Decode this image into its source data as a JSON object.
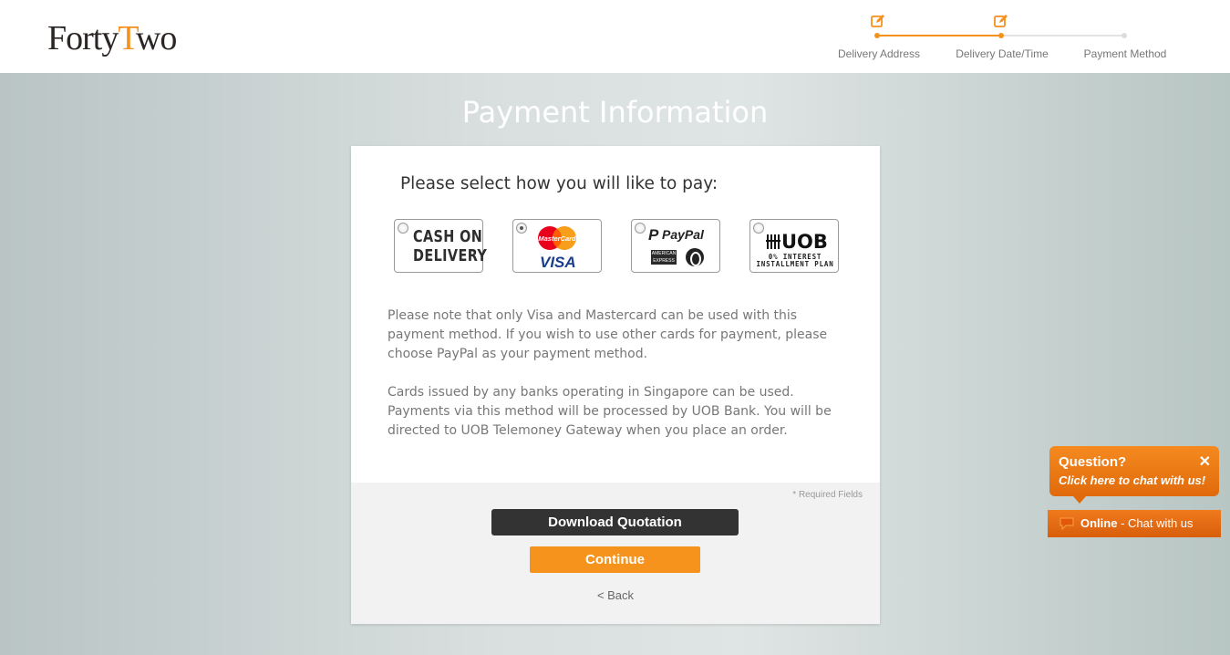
{
  "header": {
    "logo": {
      "part1": "Forty",
      "part2": "T",
      "part3": "wo"
    },
    "steps": [
      {
        "label": "Delivery Address",
        "state": "done"
      },
      {
        "label": "Delivery Date/Time",
        "state": "done"
      },
      {
        "label": "Payment Method",
        "state": "current"
      }
    ]
  },
  "main": {
    "title": "Payment Information",
    "prompt": "Please select how you will like to pay:",
    "methods": [
      {
        "id": "cash-on-delivery",
        "label_line1": "CASH ON",
        "label_line2": "DELIVERY",
        "selected": false
      },
      {
        "id": "visa-mastercard",
        "label_mc": "MasterCard",
        "label_visa": "VISA",
        "selected": true
      },
      {
        "id": "paypal",
        "label": "PayPal",
        "label_amex": "AMERICAN EXPRESS",
        "selected": false
      },
      {
        "id": "uob-installment",
        "label": "UOB",
        "sub_line1": "0% INTEREST",
        "sub_line2": "INSTALLMENT PLAN",
        "selected": false
      }
    ],
    "note1": "Please note that only Visa and Mastercard can be used with this payment method. If you wish to use other cards for payment, please choose PayPal as your payment method.",
    "note2": "Cards issued by any banks operating in Singapore can be used. Payments via this method will be processed by UOB Bank. You will be directed to UOB Telemoney Gateway when you place an order.",
    "required": "* Required Fields",
    "download_label": "Download Quotation",
    "continue_label": "Continue",
    "back_label": "< Back"
  },
  "chat": {
    "question": "Question?",
    "subtitle": "Click here to chat with us!",
    "close": "✕",
    "status": "Online",
    "status_rest": " - Chat with us"
  },
  "colors": {
    "accent": "#f6911e",
    "dark_button": "#333333",
    "chat_orange": "#f07a12"
  }
}
